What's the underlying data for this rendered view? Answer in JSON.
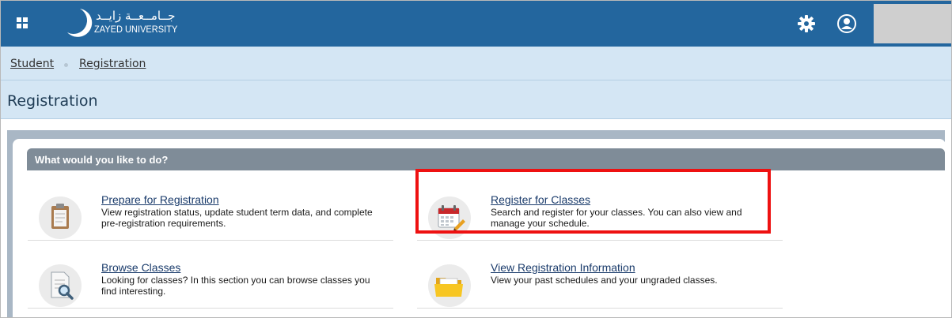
{
  "header": {
    "logo_arabic": "جــامــعــة زايــد",
    "logo_english": "ZAYED UNIVERSITY",
    "icons": {
      "apps": "grid-icon",
      "settings": "gear-icon",
      "user": "user-icon"
    },
    "colors": {
      "topbar": "#23669e",
      "breadcrumb_bg": "#d4e6f4",
      "section_head": "#7f8c98",
      "highlight": "#ee1111"
    }
  },
  "breadcrumb": {
    "items": [
      {
        "label": "Student"
      },
      {
        "label": "Registration"
      }
    ]
  },
  "page": {
    "title": "Registration"
  },
  "section": {
    "title": "What would you like to do?"
  },
  "cards": [
    {
      "link": "Prepare for Registration",
      "desc_line1": "View registration status, update student term data, and complete",
      "desc_line2": "pre-registration requirements.",
      "icon": "clipboard-icon"
    },
    {
      "link": "Register for Classes",
      "desc_line1": "Search and register for your classes. You can also view and",
      "desc_line2": "manage your schedule.",
      "icon": "calendar-edit-icon"
    },
    {
      "link": "Browse Classes",
      "desc_line1": "Looking for classes? In this section you can browse classes you",
      "desc_line2": "find interesting.",
      "icon": "document-search-icon"
    },
    {
      "link": "View Registration Information",
      "desc_line1": "View your past schedules and your ungraded classes.",
      "desc_line2": "",
      "icon": "folder-icon"
    }
  ]
}
